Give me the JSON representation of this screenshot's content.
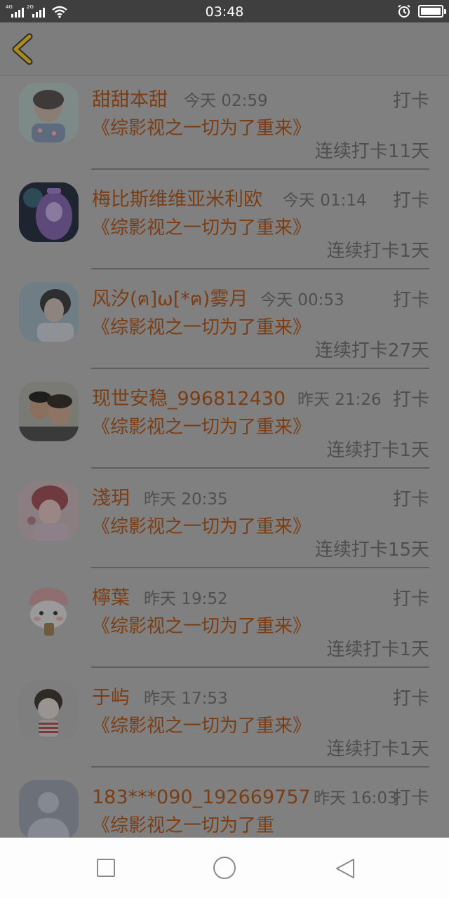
{
  "status_bar": {
    "sim1_label": "4G",
    "sim2_label": "2G",
    "time": "03:48",
    "icons": [
      "signal-icon",
      "wifi-icon",
      "alarm-icon",
      "battery-icon"
    ]
  },
  "header": {
    "back_icon": "back-chevron-icon",
    "accent_color": "#a88a1e"
  },
  "checkins": [
    {
      "name": "甜甜本甜",
      "time": "今天 02:59",
      "action": "打卡",
      "book": "《综影视之一切为了重来》",
      "streak": "连续打卡11天"
    },
    {
      "name": "梅比斯维维亚米利欧",
      "time": "今天 01:14",
      "action": "打卡",
      "book": "《综影视之一切为了重来》",
      "streak": "连续打卡1天"
    },
    {
      "name": "风汐(ฅ]ω[*ฅ)雾月",
      "time": "今天 00:53",
      "action": "打卡",
      "book": "《综影视之一切为了重来》",
      "streak": "连续打卡27天"
    },
    {
      "name": "现世安稳_996812430",
      "time": "昨天 21:26",
      "action": "打卡",
      "book": "《综影视之一切为了重来》",
      "streak": "连续打卡1天"
    },
    {
      "name": "淺玥",
      "time": "昨天 20:35",
      "action": "打卡",
      "book": "《综影视之一切为了重来》",
      "streak": "连续打卡15天"
    },
    {
      "name": "檸葉",
      "time": "昨天 19:52",
      "action": "打卡",
      "book": "《综影视之一切为了重来》",
      "streak": "连续打卡1天"
    },
    {
      "name": "于屿",
      "time": "昨天 17:53",
      "action": "打卡",
      "book": "《综影视之一切为了重来》",
      "streak": "连续打卡1天"
    },
    {
      "name": "183***090_192669757",
      "time": "昨天 16:03",
      "action": "打卡",
      "book": "《综影视之一切为了重",
      "streak": ""
    }
  ],
  "nav_bar": {
    "icons": [
      "recent-apps-icon",
      "home-icon",
      "back-icon"
    ]
  },
  "colors": {
    "name_text": "#7a3e16",
    "meta_text": "#4f4f4f",
    "overlay": "#808080"
  }
}
